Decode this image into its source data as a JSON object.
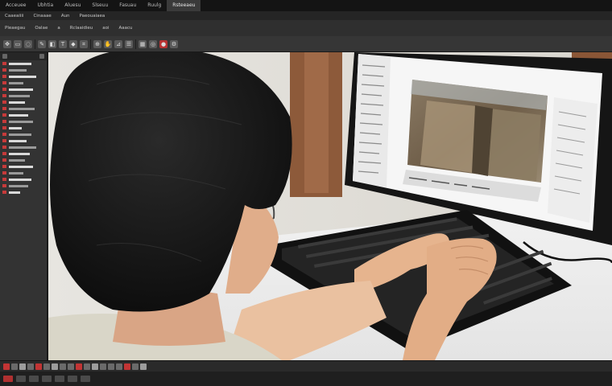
{
  "menubar": {
    "items": [
      "Acceuee",
      "Ubhtia",
      "Aluesu",
      "Slseuu",
      "Fasuau",
      "Ruulg"
    ],
    "active": "Rsteeaeu"
  },
  "row2": {
    "labels": [
      "Caaeaiiii",
      "Cinaaae",
      "Aun",
      "Paeouaiaea"
    ]
  },
  "row3": {
    "labels": [
      "Pleaegau",
      "Oalae",
      "a",
      "Rclaaidieu",
      "aoi",
      "Aaacu"
    ]
  },
  "colors": {
    "accent_red": "#c63a3a",
    "chrome_dark": "#141414",
    "panel": "#333333"
  }
}
